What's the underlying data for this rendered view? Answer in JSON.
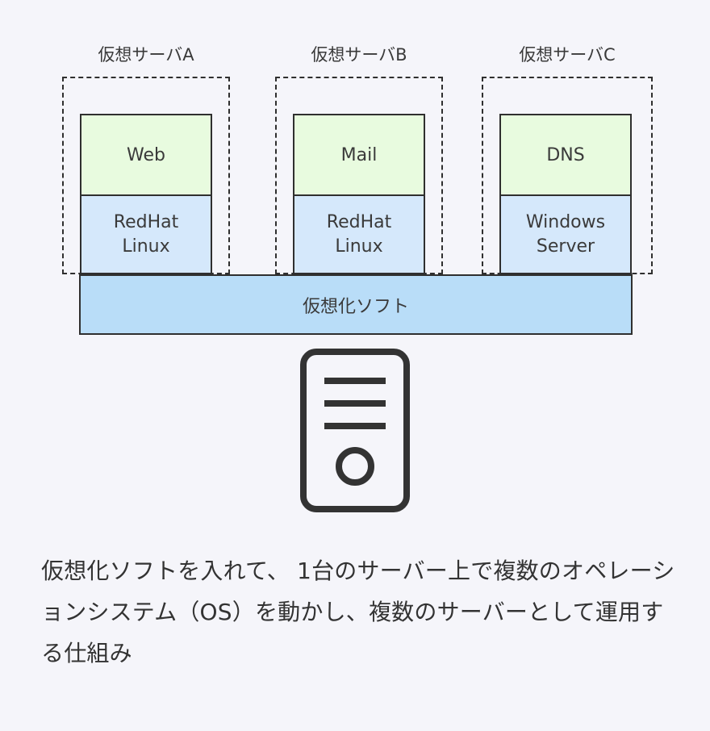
{
  "colors": {
    "background": "#f5f5fa",
    "app_fill": "#e8fbdf",
    "os_fill": "#d5e8fb",
    "hypervisor_fill": "#b9ddf8",
    "stroke": "#2f2f2f",
    "text": "#3a3a3a",
    "body_text": "#333333"
  },
  "diagram": {
    "servers": [
      {
        "caption": "仮想サーバA",
        "app": "Web",
        "os": "RedHat\nLinux",
        "app_icon": "web-service-icon",
        "os_icon": "linux-os-icon"
      },
      {
        "caption": "仮想サーバB",
        "app": "Mail",
        "os": "RedHat\nLinux",
        "app_icon": "mail-service-icon",
        "os_icon": "linux-os-icon"
      },
      {
        "caption": "仮想サーバC",
        "app": "DNS",
        "os": "Windows\nServer",
        "app_icon": "dns-service-icon",
        "os_icon": "windows-os-icon"
      }
    ],
    "hypervisor": {
      "label": "仮想化ソフト"
    },
    "hardware": {
      "icon": "server-tower-icon",
      "slot_count": 3,
      "power_button": "power-button-icon"
    }
  },
  "description": {
    "text": "仮想化ソフトを入れて、 1台のサーバー上で複数のオペレーションシステム（OS）を動かし、複数のサーバーとして運用する仕組み"
  }
}
